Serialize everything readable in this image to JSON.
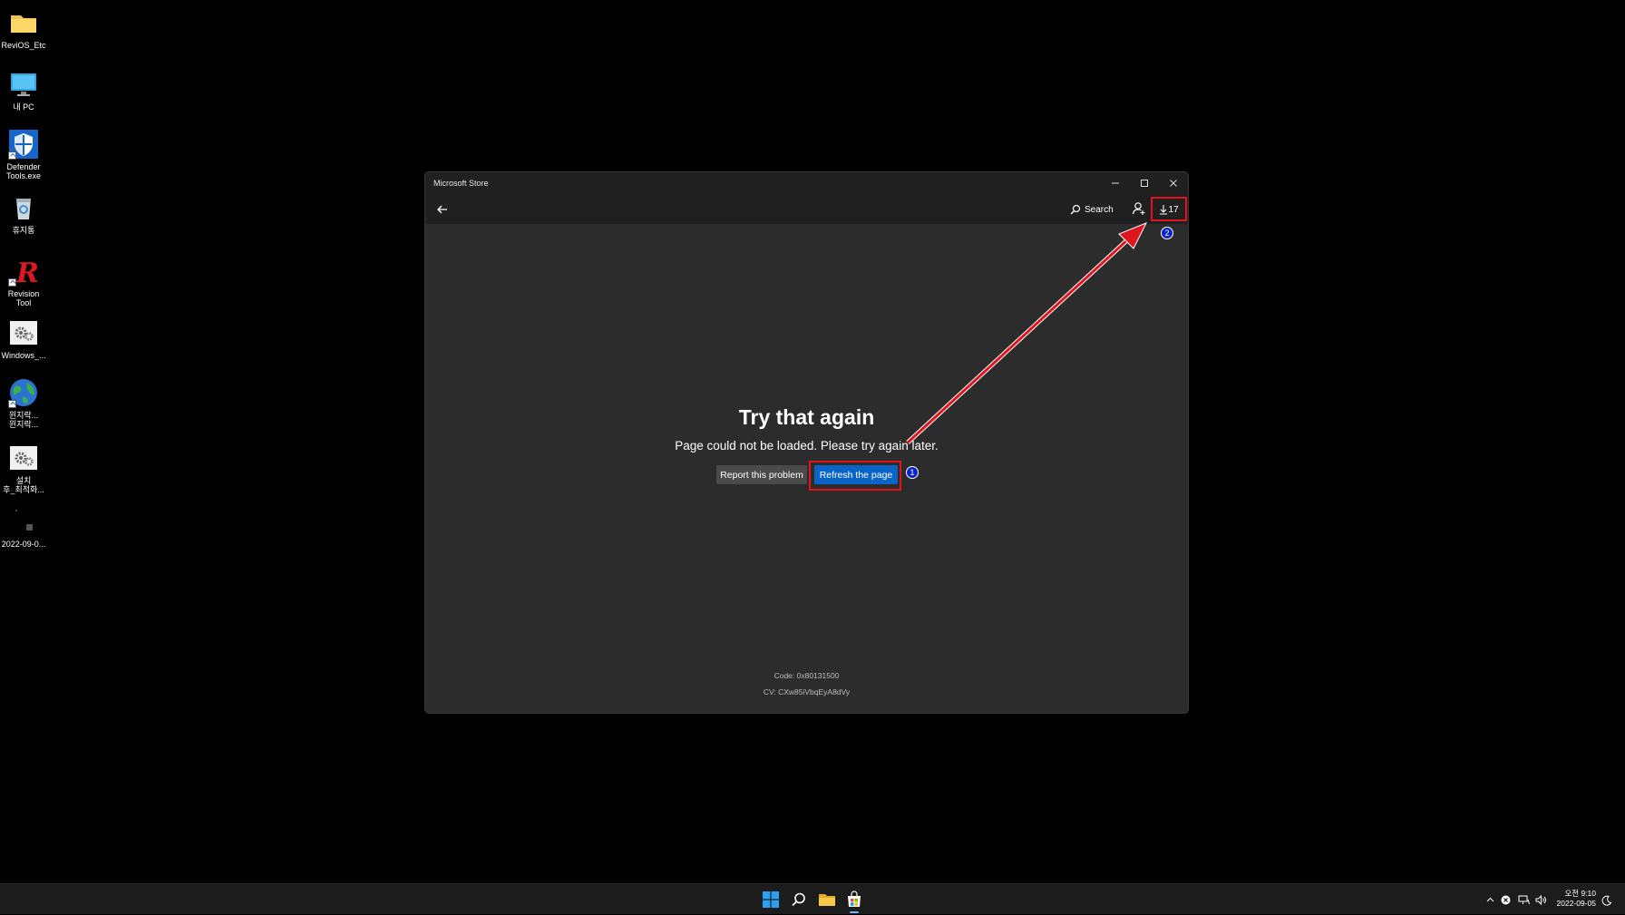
{
  "desktop": {
    "icons": [
      {
        "label": "ReviOS_Etc",
        "icon": "folder-icon"
      },
      {
        "label": "내 PC",
        "icon": "monitor-icon"
      },
      {
        "label": "Defender Tools.exe",
        "icon": "shield-icon"
      },
      {
        "label": "휴지통",
        "icon": "recycle-bin-icon"
      },
      {
        "label": "Revision Tool",
        "icon": "revision-r-icon"
      },
      {
        "label": "Windows_...",
        "icon": "settings-gears-icon"
      },
      {
        "label": "윈지락...\n윈지락...",
        "icon": "globe-icon"
      },
      {
        "label": "설치\n후_최적화...",
        "icon": "settings-gears-icon"
      },
      {
        "label": "2022-09-0...",
        "icon": "file-icon"
      }
    ]
  },
  "window": {
    "title": "Microsoft Store",
    "toolbar": {
      "search_label": "Search",
      "downloads_count": "17"
    },
    "error": {
      "title": "Try that again",
      "message": "Page could not be loaded. Please try again later.",
      "report_label": "Report this problem",
      "refresh_label": "Refresh the page",
      "code": "Code: 0x80131500",
      "cv": "CV: CXw85iVbqEyA8dVy"
    }
  },
  "annotations": {
    "marker1": "1",
    "marker2": "2",
    "color": "#e0141c"
  },
  "taskbar": {
    "apps": [
      "windows-start-icon",
      "search-icon",
      "file-explorer-icon",
      "microsoft-store-icon"
    ],
    "clock_time": "오전 9:10",
    "clock_date": "2022-09-05"
  }
}
